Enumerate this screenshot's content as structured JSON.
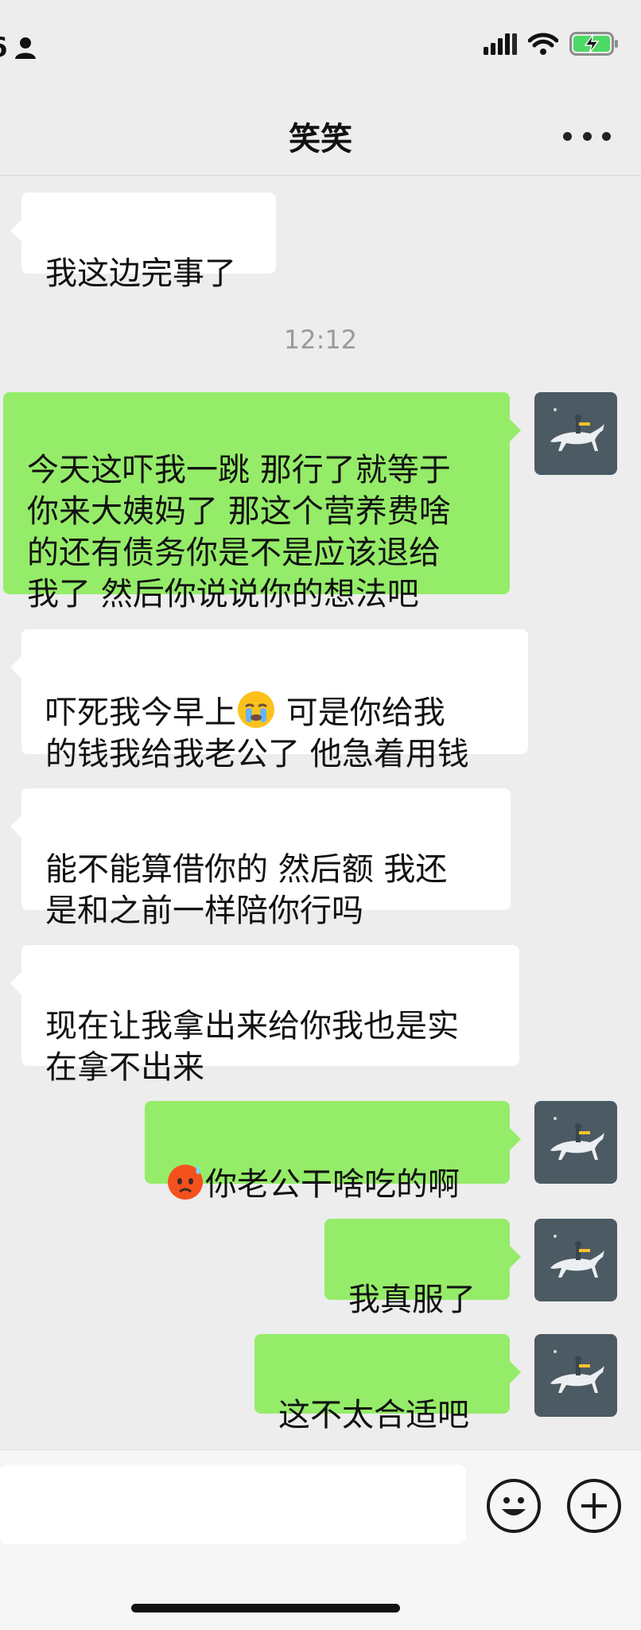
{
  "status_bar": {
    "time_partial": "6",
    "icons": [
      "person-icon",
      "cellular-signal-icon",
      "wifi-icon",
      "battery-charging-icon"
    ],
    "battery_color": "#4cd964"
  },
  "nav": {
    "title": "笑笑",
    "more_icon": "more-dots-icon"
  },
  "messages": [
    {
      "from": "contact",
      "text": "我这边完事了"
    },
    {
      "type": "timestamp",
      "text": "12:12"
    },
    {
      "from": "me",
      "text": "今天这吓我一跳 那行了就等于\n你来大姨妈了 那这个营养费啥\n的还有债务你是不是应该退给\n我了 然后你说说你的想法吧"
    },
    {
      "from": "contact",
      "text_before_emoji": "吓死我今早上",
      "emoji": "crying-emoji-icon",
      "text_after_emoji": " 可是你给我\n的钱我给我老公了 他急着用钱"
    },
    {
      "from": "contact",
      "text": " 能不能算借你的 然后额 我还\n是和之前一样陪你行吗"
    },
    {
      "from": "contact",
      "text": "现在让我拿出来给你我也是实\n在拿不出来"
    },
    {
      "from": "me",
      "emoji": "worried-sweat-emoji-icon",
      "text": "你老公干啥吃的啊"
    },
    {
      "from": "me",
      "text": "我真服了"
    },
    {
      "from": "me",
      "text": "这不太合适吧"
    }
  ],
  "avatar": {
    "icon": "horse-rider-avatar",
    "bg": "#4b5a63"
  },
  "input_bar": {
    "emoji_button_icon": "smiley-icon",
    "plus_button_icon": "plus-icon"
  },
  "colors": {
    "background": "#ededed",
    "bubble_in": "#ffffff",
    "bubble_out": "#95ec69",
    "timestamp": "#9a9a9a"
  }
}
